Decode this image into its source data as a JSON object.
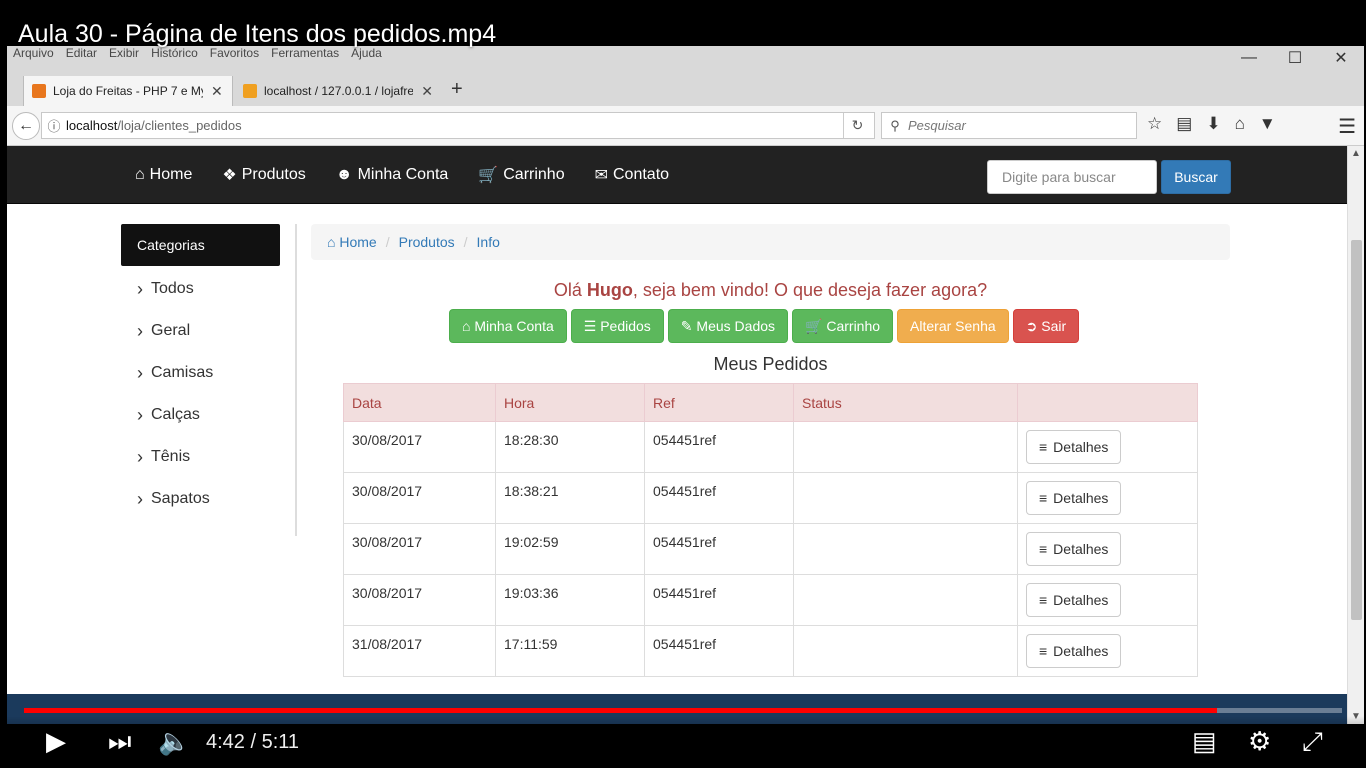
{
  "video": {
    "title": "Aula 30 - Página de Itens dos pedidos.mp4",
    "time": "4:42 / 5:11",
    "progress_fraction": 0.905
  },
  "browser": {
    "menu": [
      "Arquivo",
      "Editar",
      "Exibir",
      "Histórico",
      "Favoritos",
      "Ferramentas",
      "Ajuda"
    ],
    "tabs": [
      {
        "label": "Loja do Freitas - PHP 7 e My",
        "favicon_color": "#e8761d"
      },
      {
        "label": "localhost / 127.0.0.1 / lojafre",
        "favicon_color": "#f0a020"
      }
    ],
    "url_host": "localhost",
    "url_path": "/loja/clientes_pedidos",
    "search_placeholder": "Pesquisar"
  },
  "site": {
    "nav": [
      {
        "icon": "home-icon",
        "label": "Home"
      },
      {
        "icon": "tag-icon",
        "label": "Produtos"
      },
      {
        "icon": "user-icon",
        "label": "Minha Conta"
      },
      {
        "icon": "cart-icon",
        "label": "Carrinho"
      },
      {
        "icon": "envelope-icon",
        "label": "Contato"
      }
    ],
    "search_placeholder": "Digite para buscar",
    "search_button": "Buscar"
  },
  "sidebar": {
    "heading": "Categorias",
    "items": [
      "Todos",
      "Geral",
      "Camisas",
      "Calças",
      "Tênis",
      "Sapatos"
    ]
  },
  "breadcrumb": [
    "Home",
    "Produtos",
    "Info"
  ],
  "greeting": {
    "prefix": "Olá ",
    "name": "Hugo",
    "suffix": ", seja bem vindo! O que deseja fazer agora?"
  },
  "actions": [
    {
      "label": "Minha Conta",
      "icon": "home-icon",
      "style": "success"
    },
    {
      "label": "Pedidos",
      "icon": "barcode-icon",
      "style": "success"
    },
    {
      "label": "Meus Dados",
      "icon": "edit-icon",
      "style": "success"
    },
    {
      "label": "Carrinho",
      "icon": "cart-icon",
      "style": "success"
    },
    {
      "label": "Alterar Senha",
      "icon": "",
      "style": "warning"
    },
    {
      "label": "Sair",
      "icon": "logout-icon",
      "style": "danger"
    }
  ],
  "orders": {
    "title": "Meus Pedidos",
    "columns": [
      "Data",
      "Hora",
      "Ref",
      "Status",
      ""
    ],
    "details_label": "Detalhes",
    "rows": [
      {
        "data": "30/08/2017",
        "hora": "18:28:30",
        "ref": "054451ref",
        "status": ""
      },
      {
        "data": "30/08/2017",
        "hora": "18:38:21",
        "ref": "054451ref",
        "status": ""
      },
      {
        "data": "30/08/2017",
        "hora": "19:02:59",
        "ref": "054451ref",
        "status": ""
      },
      {
        "data": "30/08/2017",
        "hora": "19:03:36",
        "ref": "054451ref",
        "status": ""
      },
      {
        "data": "31/08/2017",
        "hora": "17:11:59",
        "ref": "054451ref",
        "status": ""
      }
    ]
  }
}
